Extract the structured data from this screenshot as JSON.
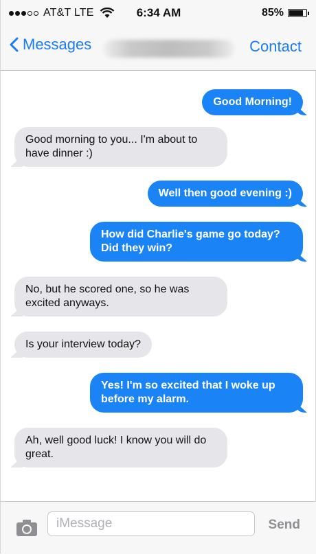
{
  "status_bar": {
    "carrier": "AT&T LTE",
    "time": "6:34 AM",
    "battery_text": "85%",
    "battery_level": 0.85,
    "signal_bars_filled": 3,
    "signal_bars_total": 5
  },
  "nav": {
    "back_label": "Messages",
    "contact_label": "Contact"
  },
  "messages": [
    {
      "direction": "sent",
      "text": "Good Morning!"
    },
    {
      "direction": "received",
      "text": "Good morning to you... I'm about to have dinner :)"
    },
    {
      "direction": "sent",
      "text": "Well then good evening :)"
    },
    {
      "direction": "sent",
      "text": "How did Charlie's game go today? Did they win?"
    },
    {
      "direction": "received",
      "text": "No, but he scored one, so he was excited anyways."
    },
    {
      "direction": "received",
      "text": "Is your interview today?"
    },
    {
      "direction": "sent",
      "text": "Yes! I'm so excited that I woke up before my alarm."
    },
    {
      "direction": "received",
      "text": "Ah, well good luck! I know you will do great."
    }
  ],
  "composer": {
    "placeholder": "iMessage",
    "send_label": "Send"
  },
  "colors": {
    "accent": "#1a7cf5",
    "sent_bubble": "#1a84f6",
    "received_bubble": "#e5e5ea"
  }
}
